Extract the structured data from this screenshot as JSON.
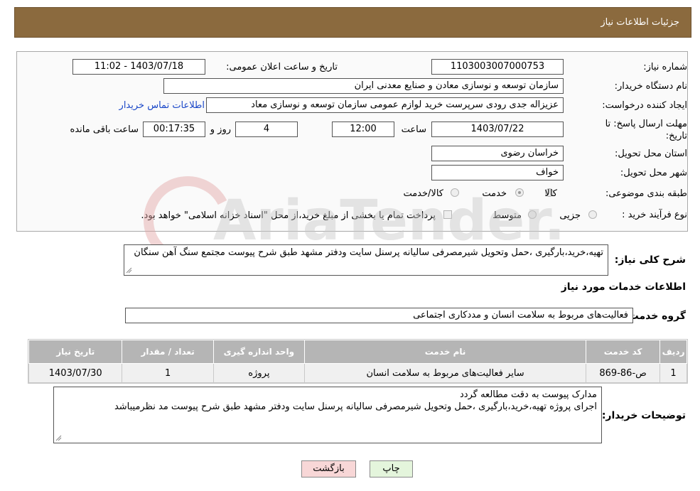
{
  "header": {
    "title": "جزئیات اطلاعات نیاز"
  },
  "form": {
    "need_number": {
      "label": "شماره نیاز:",
      "value": "1103003007000753"
    },
    "announce_datetime": {
      "label": "تاریخ و ساعت اعلان عمومی:",
      "value": "1403/07/18 - 11:02"
    },
    "buyer_org": {
      "label": "نام دستگاه خریدار:",
      "value": "سازمان توسعه و نوسازی معادن و صنایع معدنی ایران"
    },
    "requester": {
      "label": "ایجاد کننده درخواست:",
      "value": "عزیزاله جدی رودی سرپرست خرید لوازم عمومی  سازمان توسعه و نوسازی معاد",
      "contact_link": "اطلاعات تماس خریدار"
    },
    "deadline": {
      "label_line1": "مهلت ارسال پاسخ: تا",
      "label_line2": "تاریخ:",
      "date": "1403/07/22",
      "time_label": "ساعت",
      "time": "12:00",
      "days": "4",
      "days_label": "روز و",
      "remaining": "00:17:35",
      "remaining_label": "ساعت باقی مانده"
    },
    "province": {
      "label": "استان محل تحویل:",
      "value": "خراسان رضوی"
    },
    "city": {
      "label": "شهر محل تحویل:",
      "value": "خواف"
    },
    "category": {
      "label": "طبقه بندی موضوعی:",
      "options": [
        "کالا",
        "خدمت",
        "کالا/خدمت"
      ],
      "selected": "خدمت"
    },
    "purchase_type": {
      "label": "نوع فرآیند خرید :",
      "options": [
        "جزیی",
        "متوسط"
      ],
      "selected": "",
      "payment_note": "پرداخت تمام یا بخشی از مبلغ خرید،از محل \"اسناد خزانه اسلامی\" خواهد بود."
    }
  },
  "description": {
    "label": "شرح کلی نیاز:",
    "text": "تهیه،خرید،بارگیری  ،حمل وتحویل شیرمصرفی سالیانه پرسنل سایت ودفتر مشهد طبق شرح پیوست مجتمع سنگ آهن سنگان"
  },
  "services_section": {
    "title": "اطلاعات خدمات مورد نیاز",
    "group_label": "گروه خدمت:",
    "group_value": "فعالیت‌های مربوط به سلامت انسان و مددکاری اجتماعی",
    "table": {
      "columns": [
        "ردیف",
        "کد خدمت",
        "نام خدمت",
        "واحد اندازه گیری",
        "تعداد / مقدار",
        "تاریخ نیاز"
      ],
      "rows": [
        [
          "1",
          "ص-86-869",
          "سایر فعالیت‌های مربوط به سلامت انسان",
          "پروژه",
          "1",
          "1403/07/30"
        ]
      ]
    }
  },
  "buyer_notes": {
    "label": "توضیحات خریدار:",
    "line1": "مدارک پیوست به دقت مطالعه گردد",
    "line2": "اجرای پروژه تهیه،خرید،بارگیری ،حمل وتحویل شیرمصرفی سالیانه پرسنل سایت ودفتر مشهد طبق شرح پیوست مد نظرمیباشد"
  },
  "buttons": {
    "print": "چاپ",
    "back": "بازگشت"
  },
  "watermark": {
    "text": "AriaTender.net"
  },
  "colors": {
    "header_bg": "#8b6a3e",
    "table_header_bg": "#b5b5b5",
    "back_button_bg": "#f8d7d7",
    "print_button_bg": "#e4f5dc",
    "link": "#1a47c8"
  }
}
